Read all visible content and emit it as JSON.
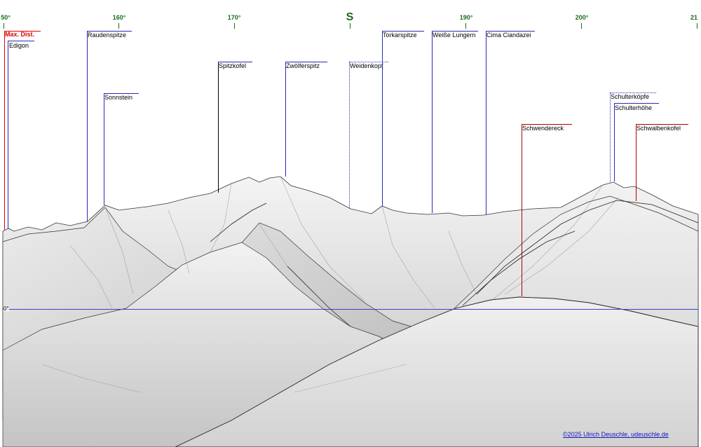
{
  "colors": {
    "degree_text": "#1a6b1a",
    "visible_peak": "#2a2ab8",
    "hidden_peak": "#b00000",
    "max_dist": "#e00000",
    "horizon": "#4040c0",
    "credit": "#1515c0"
  },
  "compass": {
    "south_label": "S",
    "degree_labels": [
      "50°",
      "160°",
      "170°",
      "190°",
      "200°",
      "21"
    ]
  },
  "max_distance": {
    "label": "Max. Dist."
  },
  "horizon": {
    "label": "0°"
  },
  "peaks": [
    {
      "name": "Edigon",
      "style": "visible"
    },
    {
      "name": "Raudenspitze",
      "style": "visible"
    },
    {
      "name": "Sonnstein",
      "style": "visible"
    },
    {
      "name": "Spitzkofel",
      "style": "visible"
    },
    {
      "name": "Zwölferspitz",
      "style": "visible"
    },
    {
      "name": "Weidenkopf",
      "style": "dotted"
    },
    {
      "name": "Torkarspitze",
      "style": "visible"
    },
    {
      "name": "Weiße Lungern",
      "style": "visible"
    },
    {
      "name": "Cima Ciandazei",
      "style": "visible"
    },
    {
      "name": "Schwendereck",
      "style": "hidden"
    },
    {
      "name": "Schulterköpfe",
      "style": "dotted"
    },
    {
      "name": "Schulterhöhe",
      "style": "visible"
    },
    {
      "name": "Schwalbenkofel",
      "style": "hidden"
    }
  ],
  "credit": {
    "text": "©2025 Ulrich Deuschle, udeuschle.de"
  }
}
